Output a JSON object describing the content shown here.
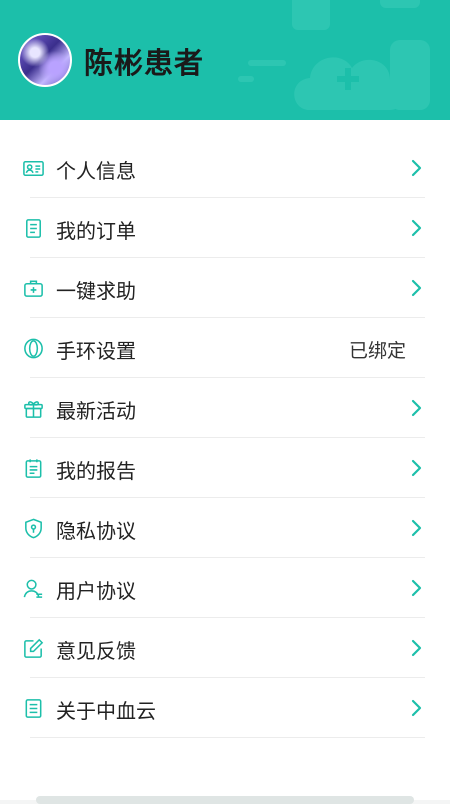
{
  "accent_color": "#1cbfaa",
  "profile": {
    "name": "陈彬患者"
  },
  "menu": {
    "items": [
      {
        "label": "个人信息",
        "icon": "id-card-icon"
      },
      {
        "label": "我的订单",
        "icon": "document-icon"
      },
      {
        "label": "一键求助",
        "icon": "medical-kit-icon"
      },
      {
        "label": "手环设置",
        "icon": "bracelet-icon",
        "value": "已绑定"
      },
      {
        "label": "最新活动",
        "icon": "gift-icon"
      },
      {
        "label": "我的报告",
        "icon": "report-icon"
      },
      {
        "label": "隐私协议",
        "icon": "shield-lock-icon"
      },
      {
        "label": "用户协议",
        "icon": "user-icon"
      },
      {
        "label": "意见反馈",
        "icon": "edit-icon"
      },
      {
        "label": "关于中血云",
        "icon": "info-doc-icon"
      }
    ]
  }
}
